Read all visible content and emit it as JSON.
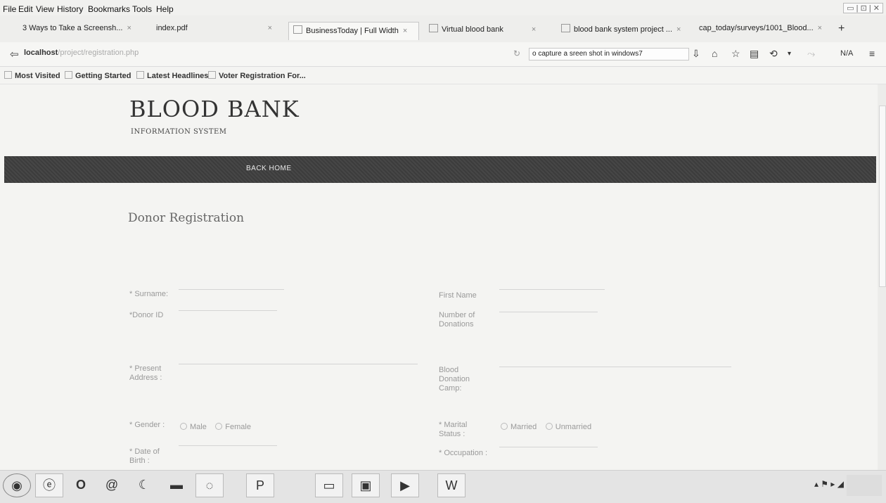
{
  "browser": {
    "menu": [
      "File",
      "Edit",
      "View",
      "History",
      "Bookmarks",
      "Tools",
      "Help"
    ],
    "tabs": [
      {
        "label": "3 Ways to Take a Screensh...",
        "active": false
      },
      {
        "label": "index.pdf",
        "active": false
      },
      {
        "label": "BusinessToday | Full Width",
        "active": true
      },
      {
        "label": "Virtual blood bank",
        "active": false
      },
      {
        "label": "blood bank system project ...",
        "active": false
      },
      {
        "label": "cap_today/surveys/1001_Blood...",
        "active": false
      }
    ],
    "url_host": "localhost",
    "url_path": "/project/registration.php",
    "search_value": "o capture a sreen shot in windows7",
    "status_na": "N/A",
    "bookmarks": [
      "Most Visited",
      "Getting Started",
      "Latest Headlines",
      "Voter Registration For..."
    ]
  },
  "site": {
    "title": "BLOOD BANK",
    "subtitle": "INFORMATION SYSTEM",
    "nav_back_home": "BACK HOME"
  },
  "form": {
    "title": "Donor Registration",
    "surname_label": "* Surname:",
    "first_name_label": "First Name",
    "donor_id_label": "*Donor ID",
    "donations_label": "Number of Donations",
    "present_address_label": "* Present Address :",
    "blood_camp_label": "Blood Donation Camp:",
    "gender_label": "* Gender :",
    "gender_options": [
      "Male",
      "Female"
    ],
    "marital_label": "* Marital Status :",
    "marital_options": [
      "Married",
      "Unmarried"
    ],
    "dob_label": "* Date of Birth :",
    "occupation_label": "* Occupation :"
  },
  "colors": {
    "nav_strip": "#3f3f3f",
    "page_bg": "#f4f4f2"
  }
}
